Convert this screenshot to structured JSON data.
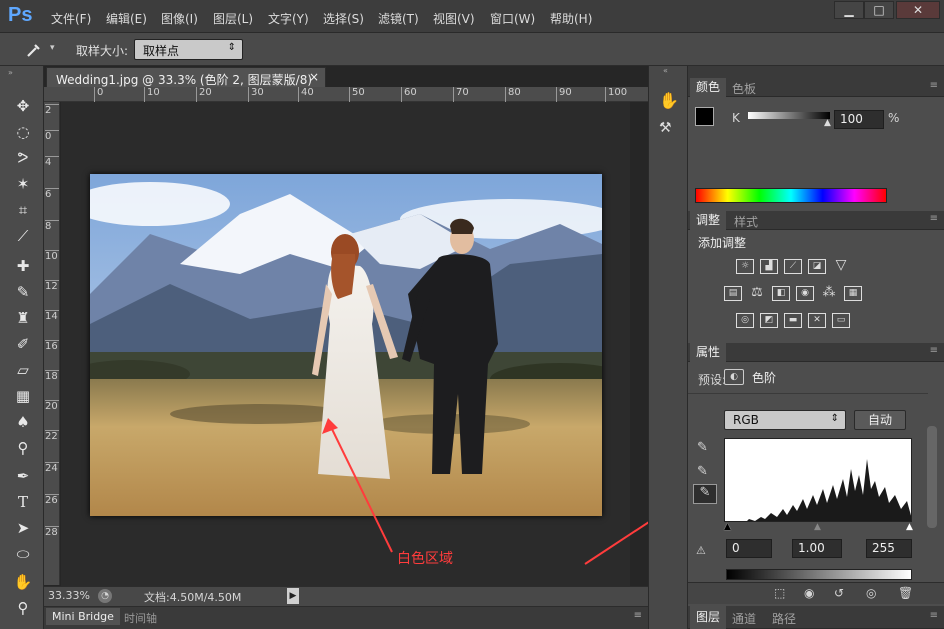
{
  "app": {
    "logo": "Ps"
  },
  "menu": [
    "文件(F)",
    "编辑(E)",
    "图像(I)",
    "图层(L)",
    "文字(Y)",
    "选择(S)",
    "滤镜(T)",
    "视图(V)",
    "窗口(W)",
    "帮助(H)"
  ],
  "window_controls": {
    "minimize": "▁",
    "maximize": "□",
    "close": "✕"
  },
  "options": {
    "tool_icon": "eyedropper-icon",
    "sample_size_label": "取样大小:",
    "sample_size_value": "取样点",
    "dropdown_arrow": "⇕"
  },
  "document": {
    "tab_title": "Wedding1.jpg @ 33.3% (色阶 2, 图层蒙版/8) *",
    "close": "×",
    "ruler_h": [
      "0",
      "10",
      "20",
      "30",
      "40",
      "50",
      "60",
      "70",
      "80",
      "90",
      "100"
    ],
    "ruler_v": [
      "2",
      "0",
      "4",
      "6",
      "8",
      "10",
      "12",
      "14",
      "16",
      "18",
      "20",
      "22",
      "24",
      "26",
      "28"
    ]
  },
  "status": {
    "zoom": "33.33%",
    "doc": "文档:4.50M/4.50M",
    "arrow": "▶"
  },
  "bottom_tabs": {
    "mini_bridge": "Mini Bridge",
    "timeline": "时间轴"
  },
  "annotation": {
    "label": "白色区域",
    "color": "#ff3c3c"
  },
  "color_panel": {
    "tab_active": "颜色",
    "tab_inactive": "色板",
    "channel": "K",
    "value": "100",
    "unit": "%"
  },
  "adjust_panel": {
    "tab_active": "调整",
    "tab_inactive": "样式",
    "title": "添加调整"
  },
  "properties_panel": {
    "tab": "属性",
    "preset_label": "预设:",
    "type_label": "色阶",
    "channel": "RGB",
    "auto_button": "自动",
    "input_black": "0",
    "input_gamma": "1.00",
    "input_white": "255"
  },
  "layers_tabs": [
    "图层",
    "通道",
    "路径"
  ],
  "colors": {
    "accent_blue": "#5fa8ff",
    "arrow_red": "#ff3c3c"
  }
}
